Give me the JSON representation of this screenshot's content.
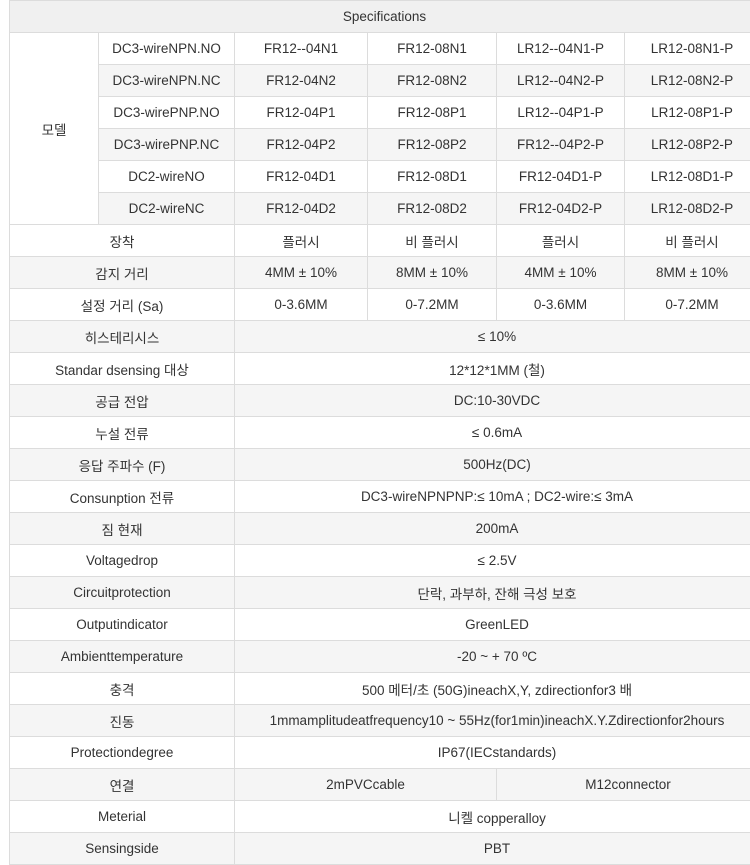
{
  "table": {
    "header": "Specifications",
    "model_label": "모델",
    "models": [
      {
        "type": "DC3-wireNPN.NO",
        "values": [
          "FR12--04N1",
          "FR12-08N1",
          "LR12--04N1-P",
          "LR12-08N1-P"
        ]
      },
      {
        "type": "DC3-wireNPN.NC",
        "values": [
          "FR12-04N2",
          "FR12-08N2",
          "LR12--04N2-P",
          "LR12-08N2-P"
        ]
      },
      {
        "type": "DC3-wirePNP.NO",
        "values": [
          "FR12-04P1",
          "FR12-08P1",
          "LR12--04P1-P",
          "LR12-08P1-P"
        ]
      },
      {
        "type": "DC3-wirePNP.NC",
        "values": [
          "FR12-04P2",
          "FR12-08P2",
          "FR12--04P2-P",
          "LR12-08P2-P"
        ]
      },
      {
        "type": "DC2-wireNO",
        "values": [
          "FR12-04D1",
          "FR12-08D1",
          "FR12-04D1-P",
          "LR12-08D1-P"
        ]
      },
      {
        "type": "DC2-wireNC",
        "values": [
          "FR12-04D2",
          "FR12-08D2",
          "FR12-04D2-P",
          "LR12-08D2-P"
        ]
      }
    ],
    "mounting": {
      "label": "장착",
      "values": [
        "플러시",
        "비 플러시",
        "플러시",
        "비 플러시"
      ]
    },
    "sensing_distance": {
      "label": "감지 거리",
      "values": [
        "4MM ± 10%",
        "8MM ± 10%",
        "4MM ± 10%",
        "8MM ± 10%"
      ]
    },
    "set_distance": {
      "label": "설정 거리 (Sa)",
      "values": [
        "0-3.6MM",
        "0-7.2MM",
        "0-3.6MM",
        "0-7.2MM"
      ]
    },
    "single_rows": [
      {
        "label": "히스테리시스",
        "value": "≤ 10%"
      },
      {
        "label": "Standar dsensing 대상",
        "value": "12*12*1MM (철)"
      },
      {
        "label": "공급 전압",
        "value": "DC:10-30VDC"
      },
      {
        "label": "누설 전류",
        "value": "≤ 0.6mA"
      },
      {
        "label": "응답 주파수 (F)",
        "value": "500Hz(DC)"
      },
      {
        "label": "Consunption 전류",
        "value": "DC3-wireNPNPNP:≤ 10mA ; DC2-wire:≤ 3mA"
      },
      {
        "label": "짐 현재",
        "value": "200mA"
      },
      {
        "label": "Voltagedrop",
        "value": "≤ 2.5V"
      },
      {
        "label": "Circuitprotection",
        "value": "단락, 과부하, 잔해 극성 보호"
      },
      {
        "label": "Outputindicator",
        "value": "GreenLED"
      },
      {
        "label": "Ambienttemperature",
        "value": "-20 ~ + 70 ºC"
      },
      {
        "label": "충격",
        "value": "500 메터/초 (50G)ineachX,Y, zdirectionfor3 배"
      },
      {
        "label": "진동",
        "value": "1mmamplitudeatfrequency10 ~ 55Hz(for1min)ineachX.Y.Zdirectionfor2hours"
      },
      {
        "label": "Protectiondegree",
        "value": "IP67(IECstandards)"
      }
    ],
    "connection": {
      "label": "연결",
      "values": [
        "2mPVCcable",
        "M12connector"
      ]
    },
    "material": {
      "label": "Meterial",
      "value": "니켈 copperalloy"
    },
    "sensing_side": {
      "label": "Sensingside",
      "value": "PBT"
    }
  }
}
